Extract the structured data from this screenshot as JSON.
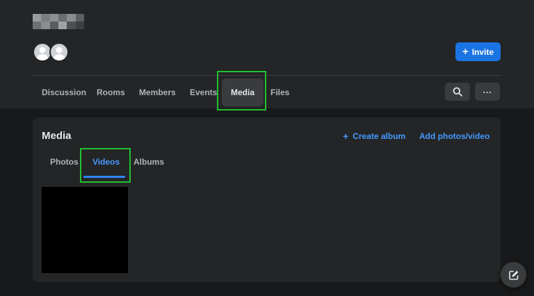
{
  "header": {
    "invite_label": "Invite",
    "plus_glyph": "+"
  },
  "nav": {
    "tabs": [
      {
        "label": "Discussion"
      },
      {
        "label": "Rooms"
      },
      {
        "label": "Members"
      },
      {
        "label": "Events"
      },
      {
        "label": "Media",
        "active": true
      },
      {
        "label": "Files"
      }
    ],
    "more_glyph": "..."
  },
  "media": {
    "title": "Media",
    "create_album_label": "Create album",
    "create_album_glyph": "+",
    "add_photos_label": "Add photos/video",
    "subtabs": [
      {
        "label": "Photos"
      },
      {
        "label": "Videos",
        "active": true
      },
      {
        "label": "Albums"
      }
    ]
  },
  "colors": {
    "page_bg": "#18191a",
    "card_bg": "#242526",
    "accent": "#1b74e4",
    "link": "#4599ff",
    "highlight": "#22c232"
  },
  "icons": {
    "search": "search-icon",
    "more": "more-icon",
    "compose": "compose-icon",
    "avatar": "default-avatar-icon"
  }
}
